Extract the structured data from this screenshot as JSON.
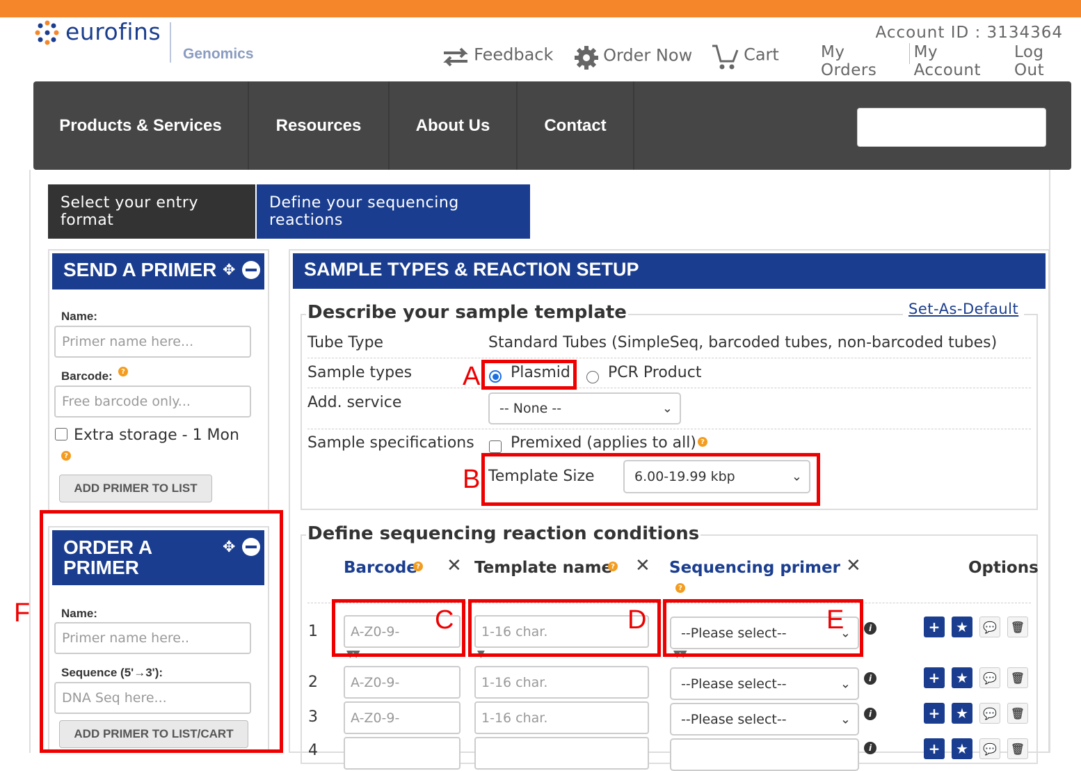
{
  "brand": {
    "name": "eurofins",
    "division": "Genomics"
  },
  "toplinks": {
    "feedback": "Feedback",
    "order_now": "Order Now",
    "cart": "Cart"
  },
  "account": {
    "id_label": "Account ID : 3134364",
    "my_orders": "My Orders",
    "my_account": "My Account",
    "logout": "Log Out"
  },
  "nav": {
    "items": [
      "Products & Services",
      "Resources",
      "About Us",
      "Contact"
    ]
  },
  "tabs": {
    "entry_format": "Select your entry format",
    "define_reactions": "Define your sequencing reactions"
  },
  "send_primer": {
    "title": "SEND A PRIMER",
    "name_label": "Name:",
    "name_placeholder": "Primer name here...",
    "barcode_label": "Barcode:",
    "barcode_placeholder": "Free barcode only...",
    "storage_label": "Extra storage - 1 Mon",
    "button": "ADD PRIMER TO LIST"
  },
  "order_primer": {
    "title_line1": "ORDER A",
    "title_line2": "PRIMER",
    "name_label": "Name:",
    "name_placeholder": "Primer name here..",
    "seq_label": "Sequence (5'→3'):",
    "seq_placeholder": "DNA Seq here...",
    "button": "ADD PRIMER TO LIST/CART"
  },
  "setup": {
    "title": "SAMPLE TYPES & REACTION SETUP",
    "describe_legend": "Describe your sample template",
    "set_default": "Set-As-Default",
    "tube_type_label": "Tube Type",
    "tube_type_value": "Standard Tubes (SimpleSeq, barcoded tubes, non-barcoded tubes)",
    "sample_types_label": "Sample types",
    "sample_type_plasmid": "Plasmid",
    "sample_type_pcr": "PCR Product",
    "add_service_label": "Add. service",
    "add_service_value": "-- None --",
    "spec_label": "Sample specifications",
    "premixed_label": "Premixed (applies to all)",
    "template_size_label": "Template Size",
    "template_size_value": "6.00-19.99 kbp"
  },
  "reactions": {
    "legend": "Define sequencing reaction conditions",
    "col_barcode": "Barcode",
    "col_template": "Template name",
    "col_primer": "Sequencing primer",
    "col_options": "Options",
    "barcode_placeholder": "A-Z0-9-",
    "template_placeholder": "1-16 char.",
    "primer_placeholder": "--Please select--",
    "rows": [
      "1",
      "2",
      "3",
      "4"
    ]
  },
  "annotations": {
    "A": "A",
    "B": "B",
    "C": "C",
    "D": "D",
    "E": "E",
    "F": "F"
  },
  "colors": {
    "brand_blue": "#1a3d8f",
    "accent_orange": "#f5862a",
    "nav_dark": "#464646",
    "annotation_red": "#e00000"
  }
}
